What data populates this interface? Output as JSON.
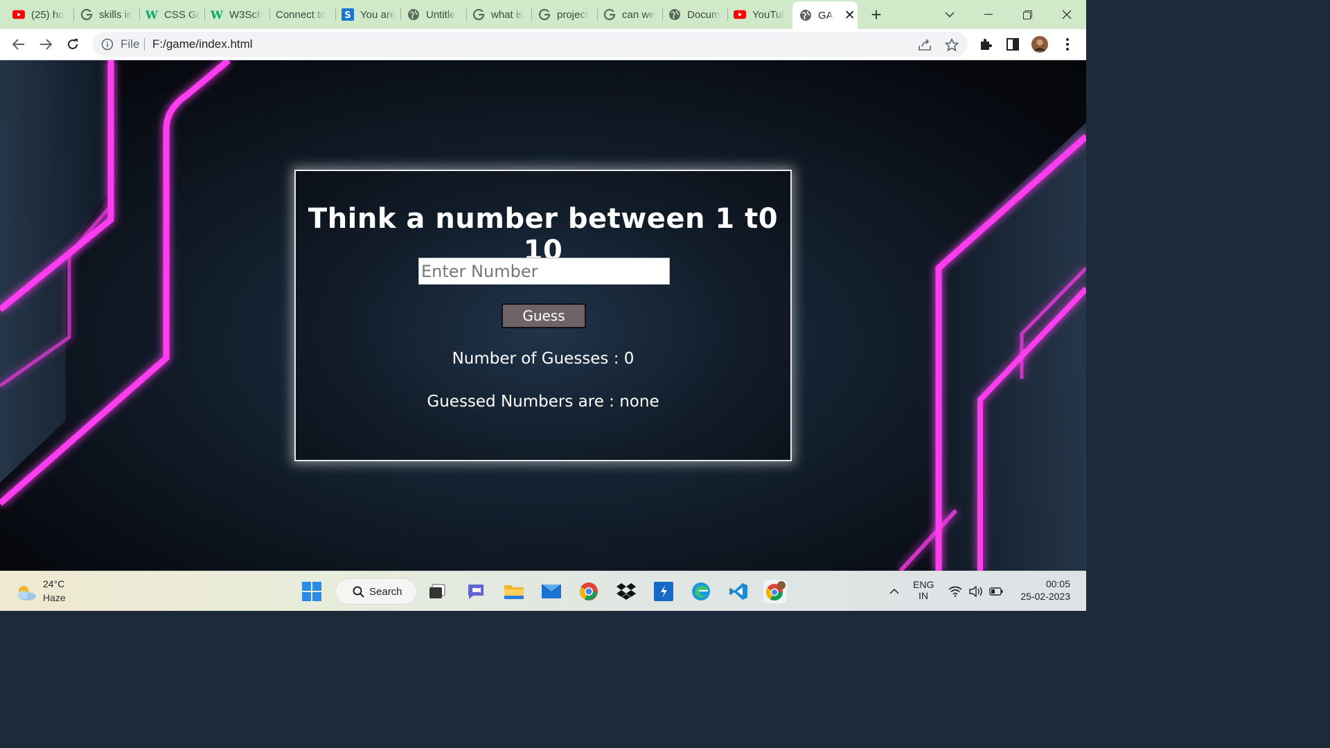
{
  "browser": {
    "tabs": [
      {
        "label": "(25) ho",
        "icon": "youtube-icon"
      },
      {
        "label": "skills in",
        "icon": "google-icon"
      },
      {
        "label": "CSS Gr",
        "icon": "w3schools-icon"
      },
      {
        "label": "W3Sch",
        "icon": "w3schools-icon"
      },
      {
        "label": "Connect to",
        "icon": "none"
      },
      {
        "label": "You are",
        "icon": "s-app-icon"
      },
      {
        "label": "Untitle",
        "icon": "globe-icon"
      },
      {
        "label": "what is",
        "icon": "google-icon"
      },
      {
        "label": "project",
        "icon": "google-icon"
      },
      {
        "label": "can we",
        "icon": "google-icon"
      },
      {
        "label": "Docum",
        "icon": "globe-icon"
      },
      {
        "label": "YouTul",
        "icon": "youtube-icon"
      }
    ],
    "active_tab": {
      "label": "GA",
      "icon": "globe-icon"
    },
    "address": {
      "scheme": "File",
      "url": "F:/game/index.html"
    }
  },
  "game": {
    "title": "Think a number between 1 t0 10",
    "input_placeholder": "Enter Number",
    "input_value": "",
    "guess_button": "Guess",
    "guess_count_text": "Number of Guesses : 0",
    "guessed_numbers_text": "Guessed Numbers are : none"
  },
  "taskbar": {
    "weather": {
      "temp": "24°C",
      "condition": "Haze"
    },
    "search_label": "Search",
    "language": {
      "line1": "ENG",
      "line2": "IN"
    },
    "clock": {
      "time": "00:05",
      "date": "25-02-2023"
    }
  },
  "colors": {
    "tabstrip": "#cfe9c9",
    "neon": "#ff3df0",
    "card_border": "#e9e9e9",
    "guess_button": "#6e6368"
  }
}
